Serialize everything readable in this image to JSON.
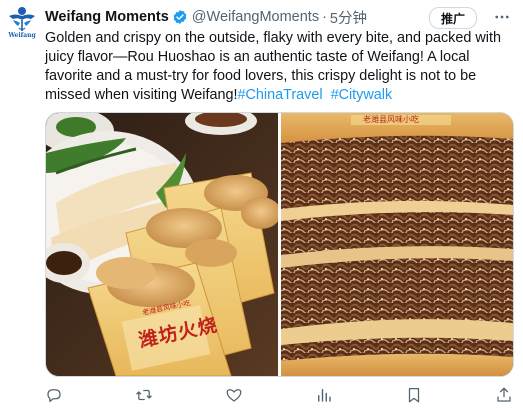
{
  "tweet": {
    "author": {
      "display_name": "Weifang Moments",
      "handle": "@WeifangMoments",
      "verified": true,
      "avatar_caption": "Weifang",
      "avatar_icon": "kite-logo-icon"
    },
    "separator": "·",
    "time": "5分钟",
    "promo_label": "推广",
    "text_body": "Golden and crispy on the outside, flaky with every bite, and packed with juicy flavor—Rou Huoshao is an authentic taste of Weifang! A local favorite and a must-try for food lovers, this crispy delight is not to be missed when visiting Weifang!",
    "hashtags": [
      "#ChinaTravel",
      "#Citywalk"
    ],
    "media": [
      {
        "name": "photo-packaged-huoshao",
        "package_text": "潍坊火烧",
        "package_subtext": "老潍县风味小吃"
      },
      {
        "name": "photo-sliced-huoshao",
        "banner_text": "老潍县风味小吃"
      }
    ],
    "actions": [
      {
        "name": "reply-button",
        "icon": "reply-icon"
      },
      {
        "name": "retweet-button",
        "icon": "retweet-icon"
      },
      {
        "name": "like-button",
        "icon": "heart-icon"
      },
      {
        "name": "views-button",
        "icon": "views-icon"
      },
      {
        "name": "bookmark-button",
        "icon": "bookmark-icon"
      },
      {
        "name": "share-button",
        "icon": "share-icon"
      }
    ],
    "colors": {
      "link": "#1d9bf0",
      "verified": "#1d9bf0",
      "secondary_text": "#536471",
      "brand_blue": "#1d5fb0"
    }
  }
}
